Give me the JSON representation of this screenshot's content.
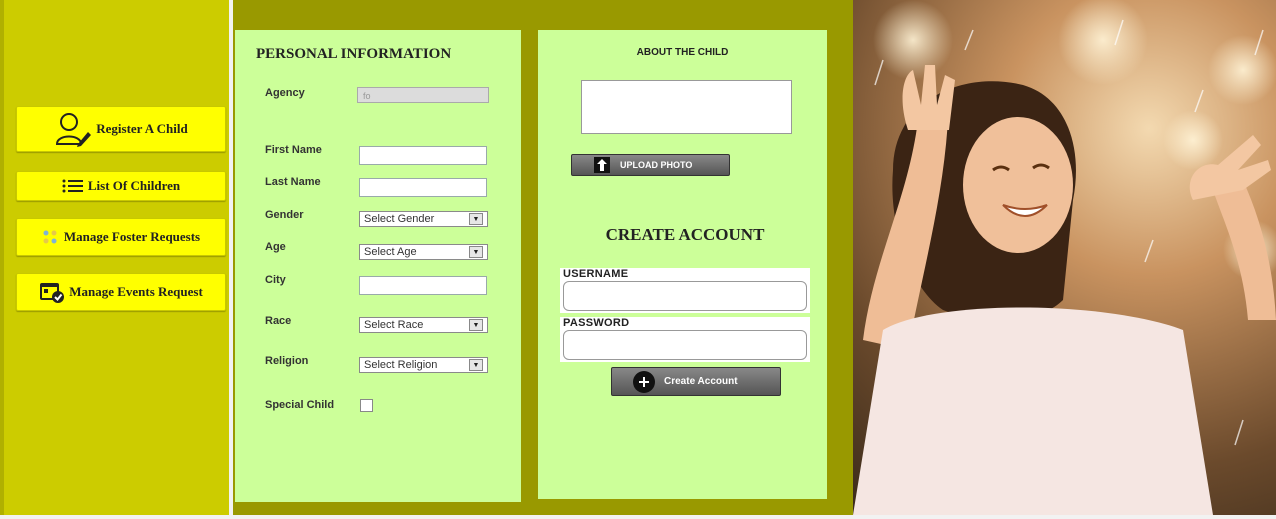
{
  "sidebar": {
    "items": [
      {
        "label": "Register A Child",
        "icon": "user-edit-icon"
      },
      {
        "label": "List Of Children",
        "icon": "list-icon"
      },
      {
        "label": "Manage Foster Requests",
        "icon": "dots-icon"
      },
      {
        "label": "Manage Events Request",
        "icon": "calendar-check-icon"
      }
    ]
  },
  "personal": {
    "title": "PERSONAL INFORMATION",
    "agency_label": "Agency",
    "agency_value": "fo",
    "first_name_label": "First Name",
    "last_name_label": "Last Name",
    "gender_label": "Gender",
    "gender_value": "Select Gender",
    "age_label": "Age",
    "age_value": "Select Age",
    "city_label": "City",
    "race_label": "Race",
    "race_value": "Select Race",
    "religion_label": "Religion",
    "religion_value": "Select Religion",
    "special_label": "Special Child"
  },
  "about": {
    "title": "ABOUT THE CHILD",
    "upload_label": "UPLOAD PHOTO"
  },
  "account": {
    "title": "CREATE ACCOUNT",
    "username_label": "USERNAME",
    "password_label": "PASSWORD",
    "create_label": "Create Account"
  },
  "colors": {
    "sidebar": "#cccc00",
    "button": "#ffff00",
    "main": "#999900",
    "panel": "#ccff99"
  }
}
